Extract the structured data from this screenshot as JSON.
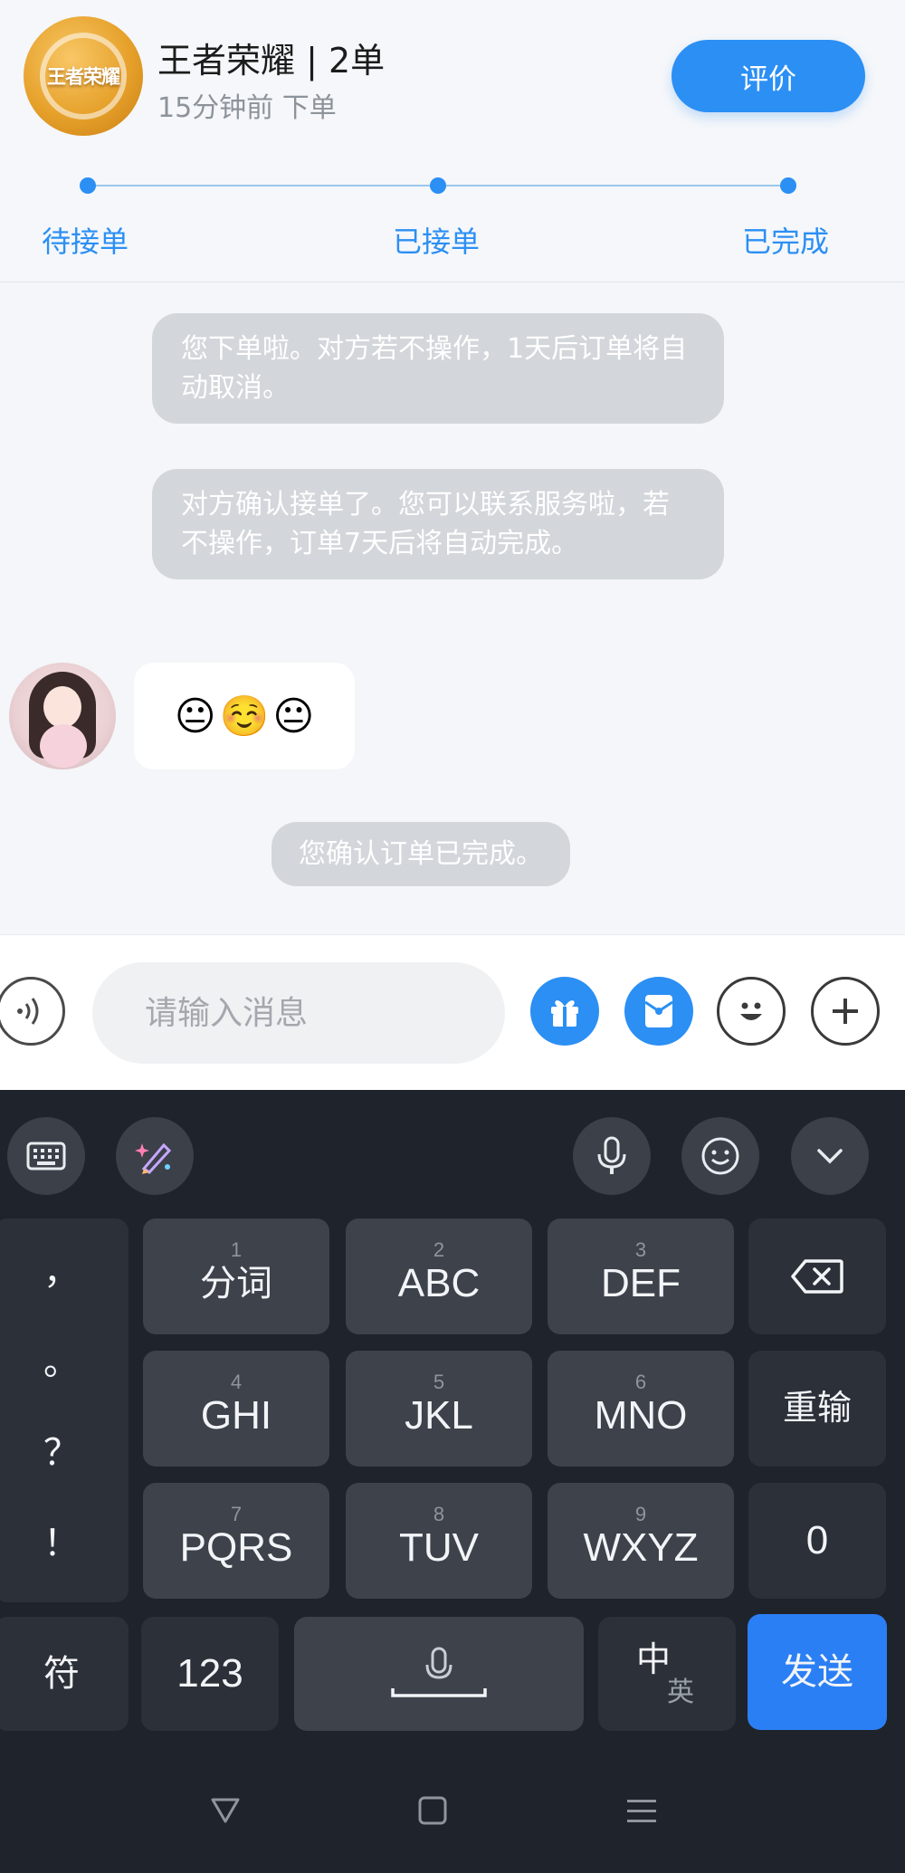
{
  "order": {
    "logo_text": "王者荣耀",
    "title": "王者荣耀 | 2单",
    "time": "15分钟前 下单",
    "rate_button": "评价",
    "steps": [
      "待接单",
      "已接单",
      "已完成"
    ]
  },
  "chat": {
    "system_messages": [
      "您下单啦。对方若不操作，1天后订单将自动取消。",
      "对方确认接单了。您可以联系服务啦，若不操作，订单7天后将自动完成。",
      "您确认订单已完成。"
    ],
    "user_message_emojis": [
      "😐",
      "☺️",
      "😐"
    ]
  },
  "input_bar": {
    "placeholder": "请输入消息",
    "icons": [
      "voice-icon",
      "gift-icon",
      "red-packet-icon",
      "emoji-icon",
      "plus-icon"
    ]
  },
  "keyboard": {
    "punctuation": [
      "，",
      "。",
      "？",
      "！"
    ],
    "rows": [
      [
        {
          "num": "1",
          "label": "分词"
        },
        {
          "num": "2",
          "label": "ABC"
        },
        {
          "num": "3",
          "label": "DEF"
        }
      ],
      [
        {
          "num": "4",
          "label": "GHI"
        },
        {
          "num": "5",
          "label": "JKL"
        },
        {
          "num": "6",
          "label": "MNO"
        }
      ],
      [
        {
          "num": "7",
          "label": "PQRS"
        },
        {
          "num": "8",
          "label": "TUV"
        },
        {
          "num": "9",
          "label": "WXYZ"
        }
      ]
    ],
    "retype": "重输",
    "zero": "0",
    "symbols": "符",
    "numbers": "123",
    "lang_zh": "中",
    "lang_en": "英",
    "send": "发送",
    "accent_color": "#2b7ff4"
  },
  "colors": {
    "accent": "#2b8ff4",
    "keyboard_bg": "#1f232b"
  }
}
